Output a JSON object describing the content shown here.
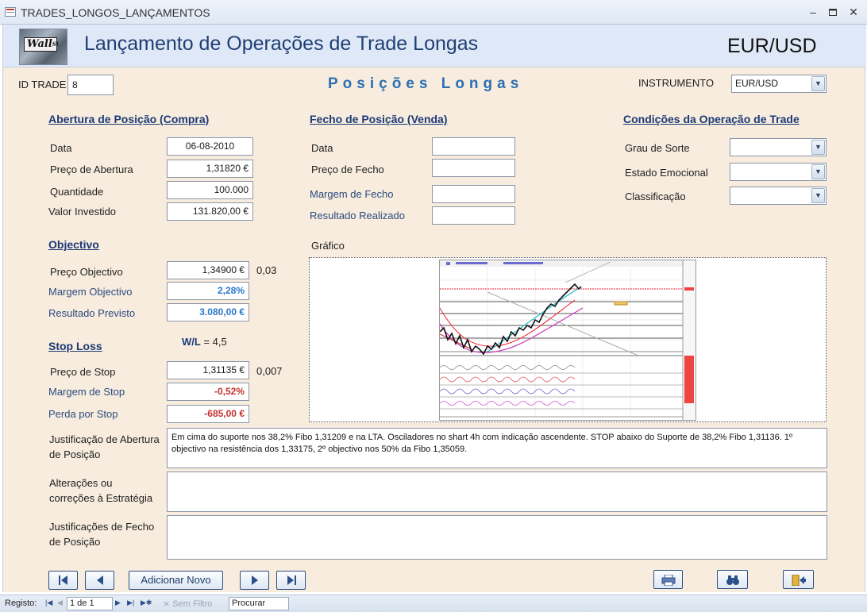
{
  "window": {
    "title": "TRADES_LONGOS_LANÇAMENTOS",
    "minimize": "–",
    "restore": "▫",
    "close": "✕"
  },
  "header": {
    "logo_text": "Wall",
    "logo_superscript": "St",
    "title": "Lançamento de Operações de Trade Longas",
    "instrument_display": "EUR/USD"
  },
  "top": {
    "id_label": "ID TRADE",
    "id_value": "8",
    "subtitle": "Posições Longas",
    "instrument_label": "INSTRUMENTO",
    "instrument_value": "EUR/USD"
  },
  "opening": {
    "section": "Abertura de Posição (Compra)",
    "date_label": "Data",
    "date_value": "06-08-2010",
    "price_label": "Preço de Abertura",
    "price_value": "1,31820 €",
    "qty_label": "Quantidade",
    "qty_value": "100.000",
    "invested_label": "Valor Investido",
    "invested_value": "131.820,00 €"
  },
  "closing": {
    "section": "Fecho de Posição (Venda)",
    "date_label": "Data",
    "price_label": "Preço de Fecho",
    "margin_label": "Margem de Fecho",
    "result_label": "Resultado Realizado"
  },
  "conditions": {
    "section": "Condições da Operação de Trade",
    "luck_label": "Grau de Sorte",
    "emotion_label": "Estado Emocional",
    "rating_label": "Classificação"
  },
  "objective": {
    "section": "Objectivo",
    "price_label": "Preço Objectivo",
    "price_value": "1,34900 €",
    "price_diff": "0,03",
    "margin_label": "Margem Objectivo",
    "margin_value": "2,28%",
    "result_label": "Resultado Previsto",
    "result_value": "3.080,00 €"
  },
  "wl": {
    "label": "W/L",
    "value": "= 4,5"
  },
  "stop": {
    "section": "Stop Loss",
    "price_label": "Preço de Stop",
    "price_value": "1,31135 €",
    "price_diff": "0,007",
    "margin_label": "Margem de Stop",
    "margin_value": "-0,52%",
    "loss_label": "Perda por Stop",
    "loss_value": "-685,00 €"
  },
  "chart": {
    "label": "Gráfico"
  },
  "memos": {
    "open_label": "Justificação de Abertura de Posição",
    "open_text": "Em cima do suporte nos 38,2% Fibo 1,31209 e na LTA. Osciladores no shart 4h com indicação ascendente. STOP abaixo do Suporte de 38,2% Fibo 1,31136. 1º objectivo na resistência dos 1,33175, 2º objectivo nos 50% da Fibo 1,35059.",
    "changes_label": "Alterações ou correções à Estratégia",
    "changes_text": "",
    "close_label": "Justificações de Fecho de Posição",
    "close_text": ""
  },
  "nav": {
    "add_new": "Adicionar Novo"
  },
  "statusbar": {
    "record_label": "Registo:",
    "record_value": "1 de 1",
    "no_filter": "Sem Filtro",
    "search_placeholder": "Procurar"
  },
  "colors": {
    "form_bg": "#f7ecdd",
    "header_bg": "#dfe8f6",
    "section_blue": "#1c3a78",
    "positive_blue": "#2a78c9",
    "negative_red": "#c53030"
  }
}
